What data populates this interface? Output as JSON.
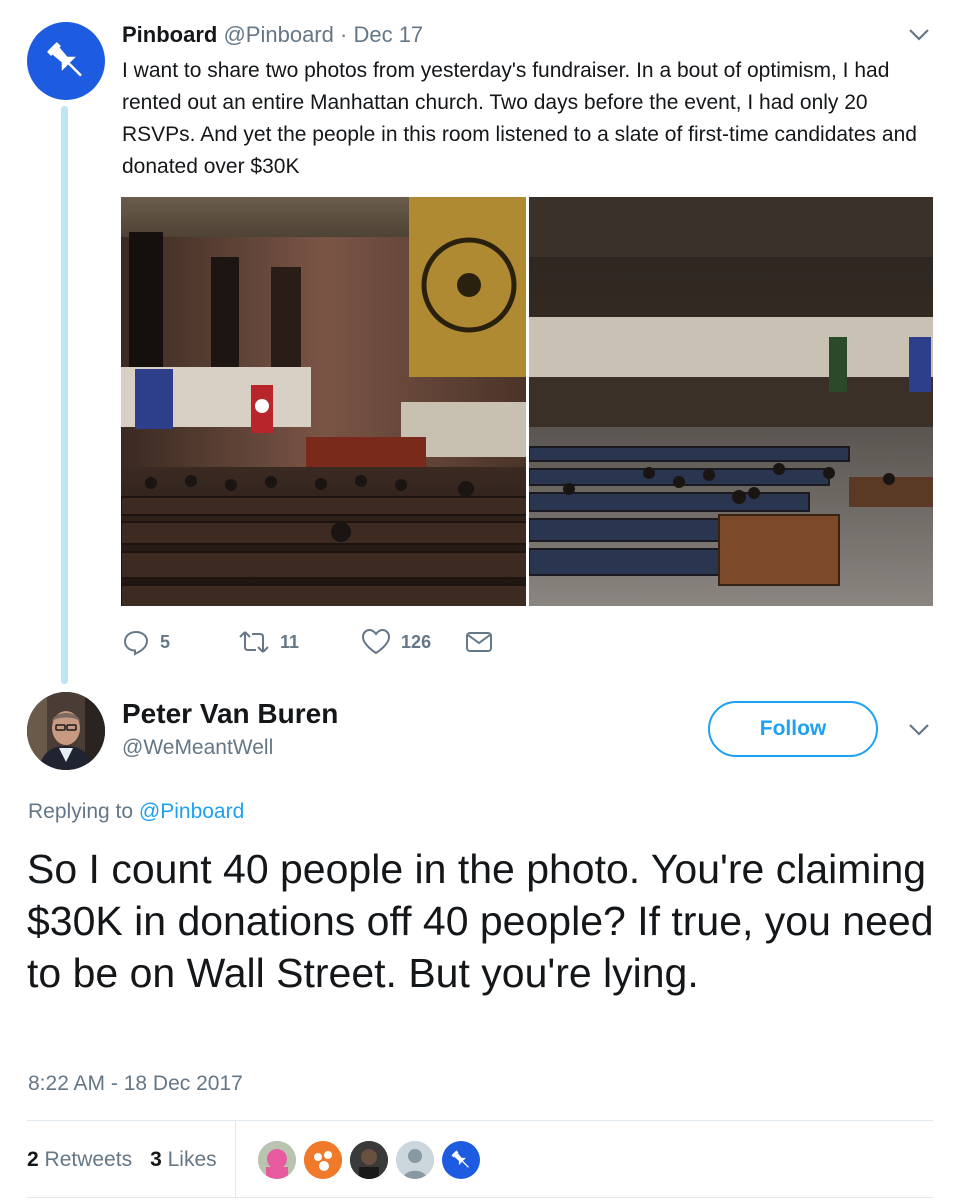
{
  "parent_tweet": {
    "display_name": "Pinboard",
    "handle": "@Pinboard",
    "separator": "·",
    "date": "Dec 17",
    "text": "I want to share two photos from yesterday's fundraiser. In a bout of optimism, I had rented out an entire Manhattan church. Two days before the event, I had only 20 RSVPs. And yet the people in this room listened to a slate of first-time candidates and donated over $30K",
    "actions": {
      "replies": "5",
      "retweets": "11",
      "likes": "126"
    }
  },
  "reply_tweet": {
    "display_name": "Peter Van Buren",
    "handle": "@WeMeantWell",
    "follow_label": "Follow",
    "replying_prefix": "Replying to",
    "replying_to": "@Pinboard",
    "text": "So I count 40 people in the photo. You're claiming $30K in donations off 40 people? If true, you need to be on Wall Street. But you're lying.",
    "timestamp": "8:22 AM - 18 Dec 2017",
    "stats": {
      "retweet_count": "2",
      "retweet_label": "Retweets",
      "like_count": "3",
      "like_label": "Likes"
    }
  },
  "icons": [
    "pin-icon",
    "chevron-down-icon",
    "reply-icon",
    "retweet-icon",
    "heart-icon",
    "message-icon"
  ],
  "colors": {
    "accent": "#1da1f2",
    "muted": "#657786",
    "thread_line": "#bfe4f5",
    "pinboard_blue": "#1d5be0"
  }
}
